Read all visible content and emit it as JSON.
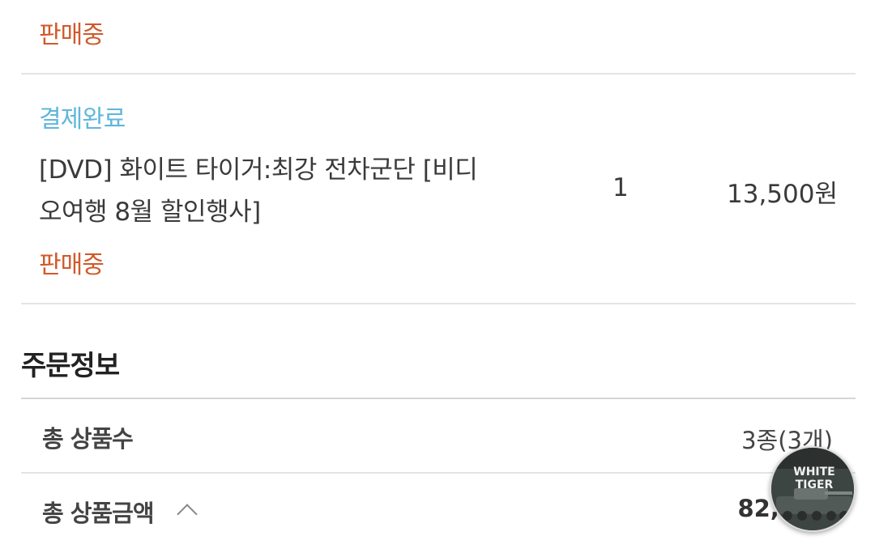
{
  "items": [
    {
      "status": "판매중"
    },
    {
      "payment_status": "결제완료",
      "name_line1": "[DVD] 화이트 타이거:최강 전차군단 [비디",
      "name_line2": "오여행 8월 할인행사]",
      "quantity": "1",
      "price": "13,500원",
      "status": "판매중"
    }
  ],
  "order_info": {
    "title": "주문정보",
    "total_count_label": "총 상품수",
    "total_count_value": "3종(3개)",
    "total_amount_label": "총 상품금액",
    "total_amount_value": "82,3",
    "expand_icon": "chevron-up-icon"
  },
  "floating_thumbnail": {
    "icon": "dvd-cover-thumbnail",
    "title_line1": "WHITE",
    "title_line2": "TIGER"
  },
  "colors": {
    "on_sale": "#cf5a2a",
    "paid": "#5fb7dd",
    "divider": "#e4e4e4"
  }
}
